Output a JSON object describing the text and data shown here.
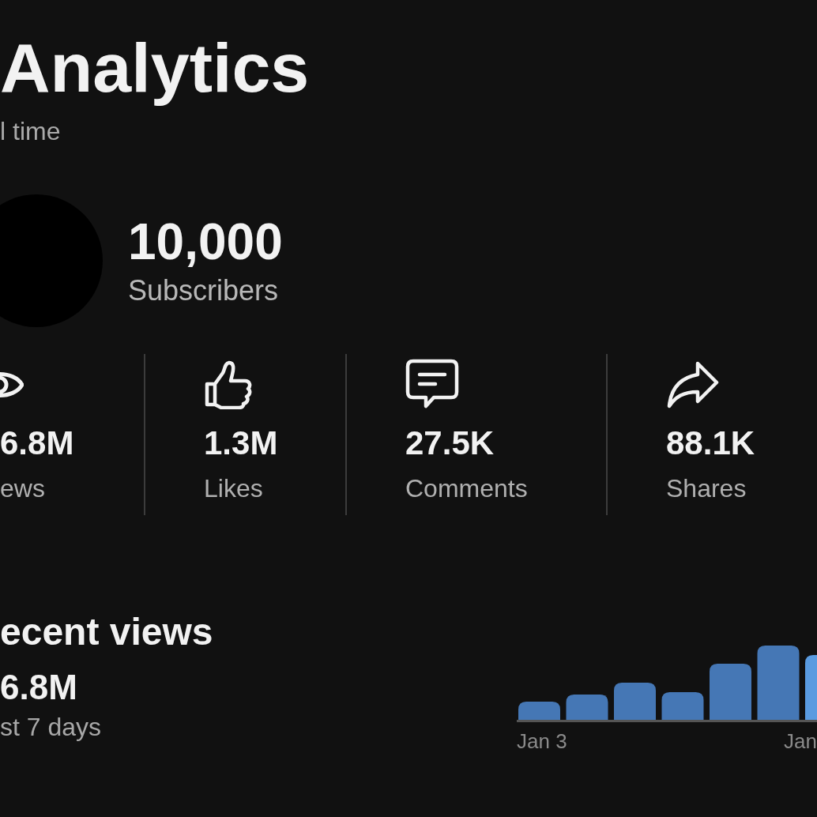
{
  "header": {
    "title": "Analytics",
    "subtitle": "l time"
  },
  "channel": {
    "count": "10,000",
    "label": "Subscribers"
  },
  "stats": [
    {
      "kind": "views",
      "value": "6.8M",
      "label": "ews"
    },
    {
      "kind": "likes",
      "value": "1.3M",
      "label": "Likes"
    },
    {
      "kind": "comments",
      "value": "27.5K",
      "label": "Comments"
    },
    {
      "kind": "shares",
      "value": "88.1K",
      "label": "Shares"
    }
  ],
  "recent": {
    "title": "ecent views",
    "value": "6.8M",
    "period": "st 7 days",
    "axis_labels": [
      "Jan 3",
      "Jan"
    ]
  }
}
